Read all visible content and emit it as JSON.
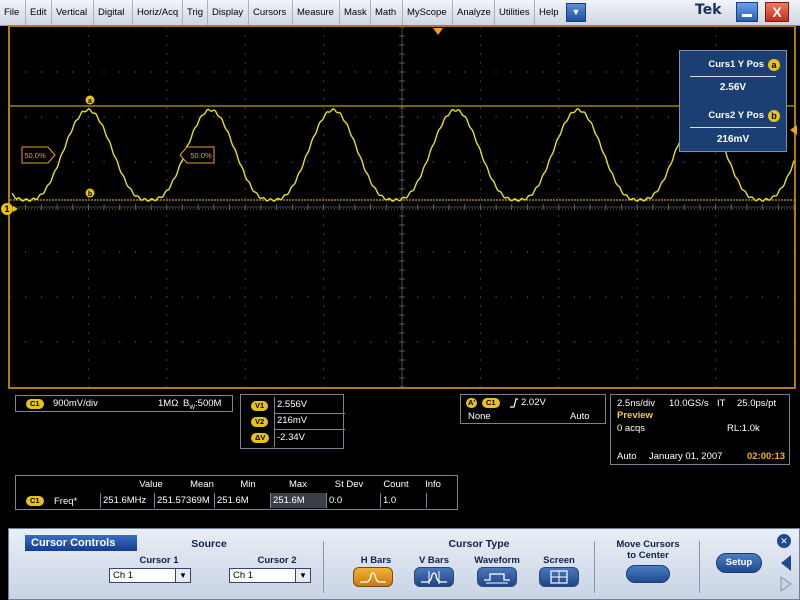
{
  "menu": {
    "items": [
      "File",
      "Edit",
      "Vertical",
      "Digital",
      "Horiz/Acq",
      "Trig",
      "Display",
      "Cursors",
      "Measure",
      "Mask",
      "Math",
      "MyScope",
      "Analyze",
      "Utilities",
      "Help"
    ],
    "dropdown_glyph": "▼",
    "brand": "Tek",
    "close_glyph": "X"
  },
  "graticule": {
    "ref_marker_a": "a",
    "ref_marker_b": "b",
    "percent_left": "50.0%",
    "percent_mid": "50.0%",
    "channel_marker": "1"
  },
  "cursor_readout": {
    "curs1_label": "Curs1 Y Pos",
    "curs1_badge": "a",
    "curs1_value": "2.56V",
    "curs2_label": "Curs2 Y Pos",
    "curs2_badge": "b",
    "curs2_value": "216mV"
  },
  "channel_status": {
    "chip": "C1",
    "scale": "900mV/div",
    "impedance": "1MΩ",
    "bw_prefix": "B",
    "bw_sub": "W",
    "bw_value": ":500M"
  },
  "cursor_values": {
    "v1_label": "V1",
    "v1": "2.556V",
    "v2_label": "V2",
    "v2": "216mV",
    "dv_label": "ΔV",
    "dv": "-2.34V"
  },
  "trigger": {
    "a_chip": "A'",
    "ch_chip": "C1",
    "level": "2.02V",
    "coupling": "None",
    "mode": "Auto"
  },
  "timebase": {
    "scale": "2.5ns/div",
    "rate": "10.0GS/s",
    "it": "IT",
    "resolution": "25.0ps/pt",
    "state": "Preview",
    "acqs": "0 acqs",
    "record_length": "RL:1.0k",
    "trigger_mode": "Auto",
    "date": "January 01, 2007",
    "time": "02:00:13"
  },
  "measurements": {
    "headers": [
      "Value",
      "Mean",
      "Min",
      "Max",
      "St Dev",
      "Count",
      "Info"
    ],
    "rows": [
      {
        "chip": "C1",
        "name": "Freq*",
        "values": [
          "251.6MHz",
          "251.57369M",
          "251.6M",
          "251.6M",
          "0.0",
          "1.0",
          ""
        ]
      }
    ]
  },
  "controls": {
    "tab": "Cursor Controls",
    "source_label": "Source",
    "cursor1_label": "Cursor 1",
    "cursor1_value": "Ch 1",
    "cursor2_label": "Cursor 2",
    "cursor2_value": "Ch 1",
    "cursor_type_label": "Cursor Type",
    "types": [
      "H Bars",
      "V Bars",
      "Waveform",
      "Screen"
    ],
    "selected_type": "H Bars",
    "move_label_1": "Move Cursors",
    "move_label_2": "to Center",
    "setup": "Setup",
    "close_glyph": "✕"
  },
  "colors": {
    "trace": "#e8e020",
    "cursor": "#e6c21a",
    "frame": "#b07a10",
    "accent": "#1c3f73",
    "time": "#f0b030"
  }
}
